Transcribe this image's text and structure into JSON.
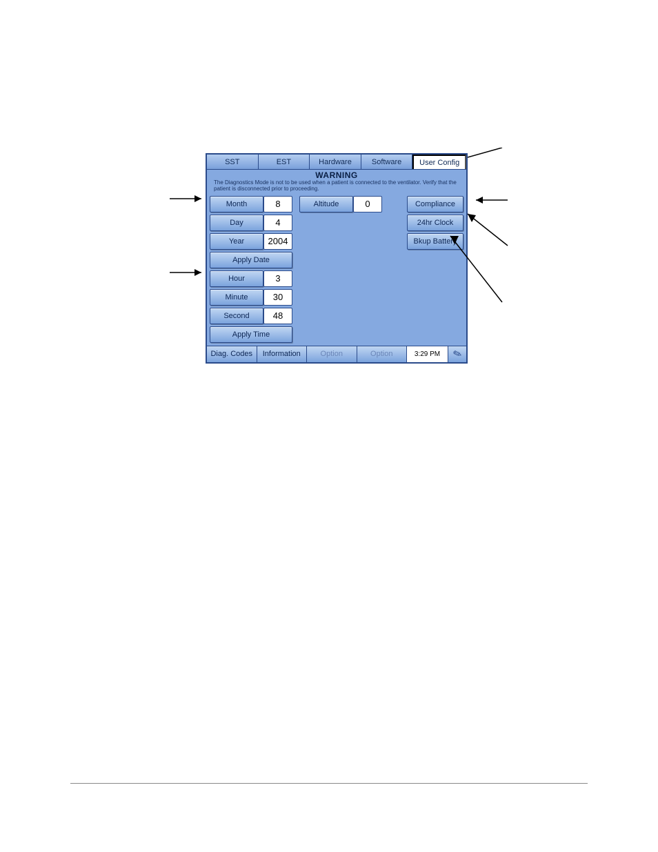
{
  "tabs": {
    "sst": "SST",
    "est": "EST",
    "hardware": "Hardware",
    "software": "Software",
    "user_config": "User Config"
  },
  "warning": {
    "title": "WARNING",
    "body": "The Diagnostics Mode is not to be used when a patient is connected to the ventilator. Verify that the patient is disconnected prior to proceeding."
  },
  "date": {
    "month_label": "Month",
    "month_value": "8",
    "day_label": "Day",
    "day_value": "4",
    "year_label": "Year",
    "year_value": "2004",
    "apply_label": "Apply Date"
  },
  "time": {
    "hour_label": "Hour",
    "hour_value": "3",
    "minute_label": "Minute",
    "minute_value": "30",
    "second_label": "Second",
    "second_value": "48",
    "apply_label": "Apply Time"
  },
  "altitude": {
    "label": "Altitude",
    "value": "0"
  },
  "side_buttons": {
    "compliance": "Compliance",
    "clock24": "24hr Clock",
    "bkup_battery": "Bkup Battery"
  },
  "footer": {
    "diag_codes": "Diag. Codes",
    "information": "Information",
    "option1": "Option",
    "option2": "Option",
    "clock": "3:29 PM"
  }
}
